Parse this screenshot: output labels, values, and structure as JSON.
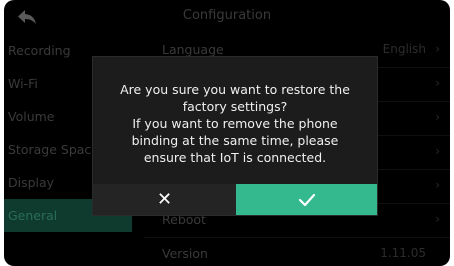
{
  "header": {
    "title": "Configuration",
    "back_icon": "back-arrow-icon"
  },
  "sidebar": {
    "items": [
      {
        "label": "Recording",
        "active": false
      },
      {
        "label": "Wi-Fi",
        "active": false
      },
      {
        "label": "Volume",
        "active": false
      },
      {
        "label": "Storage Space",
        "active": false
      },
      {
        "label": "Display",
        "active": false
      },
      {
        "label": "General",
        "active": true
      }
    ]
  },
  "settings": {
    "rows": [
      {
        "label": "Language",
        "value": "English"
      },
      {
        "label": "",
        "value": ""
      },
      {
        "label": "",
        "value": ""
      },
      {
        "label": "",
        "value": ""
      },
      {
        "label": "",
        "value": ""
      },
      {
        "label": "Reboot",
        "value": ""
      },
      {
        "label": "Version",
        "value": "1.11.05"
      }
    ]
  },
  "dialog": {
    "message": "Are you sure you want to restore the\nfactory settings?\nIf you want to remove the phone\nbinding at the same time, please\nensure that IoT is connected.",
    "cancel_icon": "close-icon",
    "confirm_icon": "check-icon",
    "cancel_glyph": "✕"
  },
  "colors": {
    "accent": "#33b98d",
    "background": "#000000",
    "dialog_bg": "#1c1c1c",
    "active_sidebar_bg": "#0f3a2e"
  }
}
